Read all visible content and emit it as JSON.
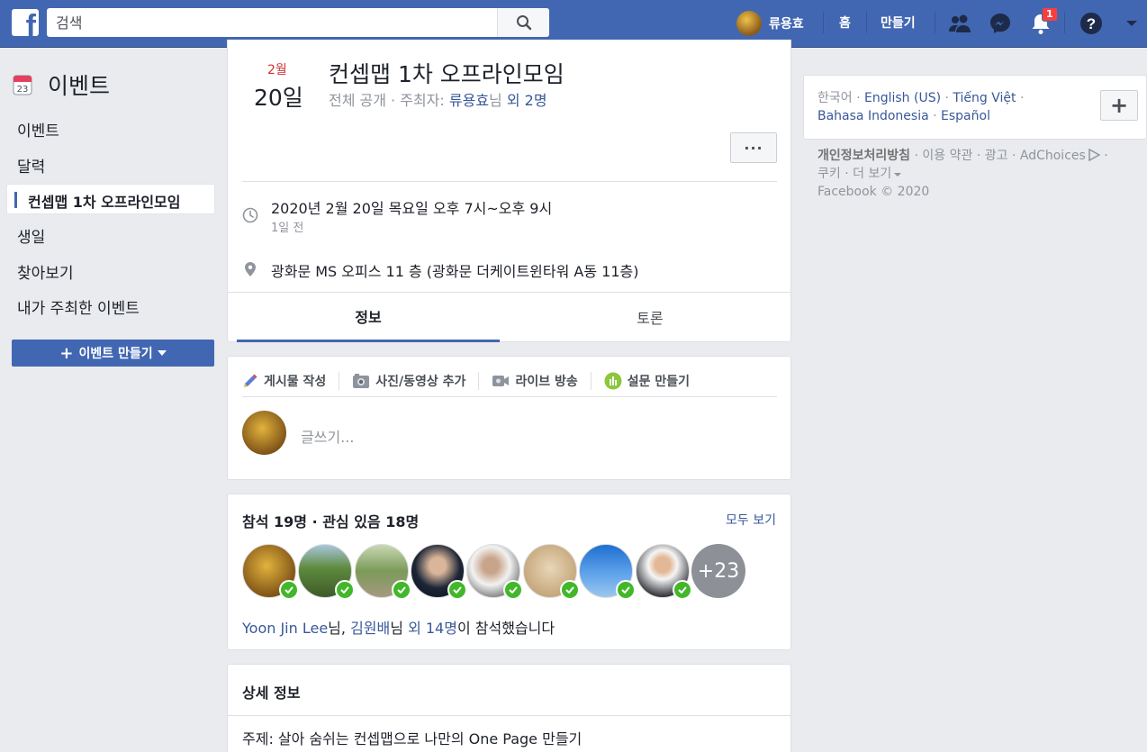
{
  "topbar": {
    "logo": "f",
    "search_placeholder": "검색",
    "profile_name": "류용효",
    "home": "홈",
    "create": "만들기",
    "notification_count": "1"
  },
  "sidebar": {
    "title": "이벤트",
    "calendar_number": "23",
    "items": [
      {
        "label": "이벤트"
      },
      {
        "label": "달력"
      },
      {
        "label": "컨셉맵 1차 오프라인모임"
      },
      {
        "label": "생일"
      },
      {
        "label": "찾아보기"
      },
      {
        "label": "내가 주최한 이벤트"
      }
    ],
    "create_button": "이벤트 만들기"
  },
  "event": {
    "month": "2월",
    "day": "20일",
    "title": "컨셉맵 1차 오프라인모임",
    "privacy": "전체 공개 · 주최자: ",
    "host": "류용효",
    "host_suffix": "님 ",
    "others": "외 2명",
    "more": "···",
    "time": "2020년 2월 20일 목요일 오후 7시~오후 9시",
    "time_ago": "1일 전",
    "place": "광화문 MS 오피스 11 층 (광화문 더케이트윈타워 A동 11층)",
    "tabs": [
      {
        "label": "정보"
      },
      {
        "label": "토론"
      }
    ]
  },
  "composer": {
    "actions": [
      {
        "label": "게시물 작성",
        "icon": "pencil-icon"
      },
      {
        "label": "사진/동영상 추가",
        "icon": "camera-icon"
      },
      {
        "label": "라이브 방송",
        "icon": "video-camera-icon"
      },
      {
        "label": "설문 만들기",
        "icon": "poll-icon"
      }
    ],
    "placeholder": "글쓰기..."
  },
  "attendance": {
    "title": "참석 19명 · 관심 있음 18명",
    "see_all": "모두 보기",
    "more_count": "+23",
    "name1": "Yoon Jin Lee",
    "sep1": "님, ",
    "name2": "김원배",
    "sep2": "님 ",
    "others": "외 14명",
    "suffix": "이 참석했습니다"
  },
  "details": {
    "title": "상세 정보",
    "text": "주제: 살아 숨쉬는 컨셉맵으로 나만의 One Page 만들기"
  },
  "right": {
    "lang_current": "한국어",
    "languages": [
      "English (US)",
      "Tiếng Việt",
      "Bahasa Indonesia",
      "Español"
    ],
    "lang_add": "+",
    "privacy": "개인정보처리방침",
    "terms": "이용 약관",
    "ads": "광고",
    "adchoices": "AdChoices",
    "cookies": "쿠키",
    "more": "더 보기",
    "copyright": "Facebook © 2020"
  },
  "colors": {
    "brand": "#4267b2",
    "link": "#385898",
    "check": "#42b72a",
    "date_red": "#cf3233"
  }
}
